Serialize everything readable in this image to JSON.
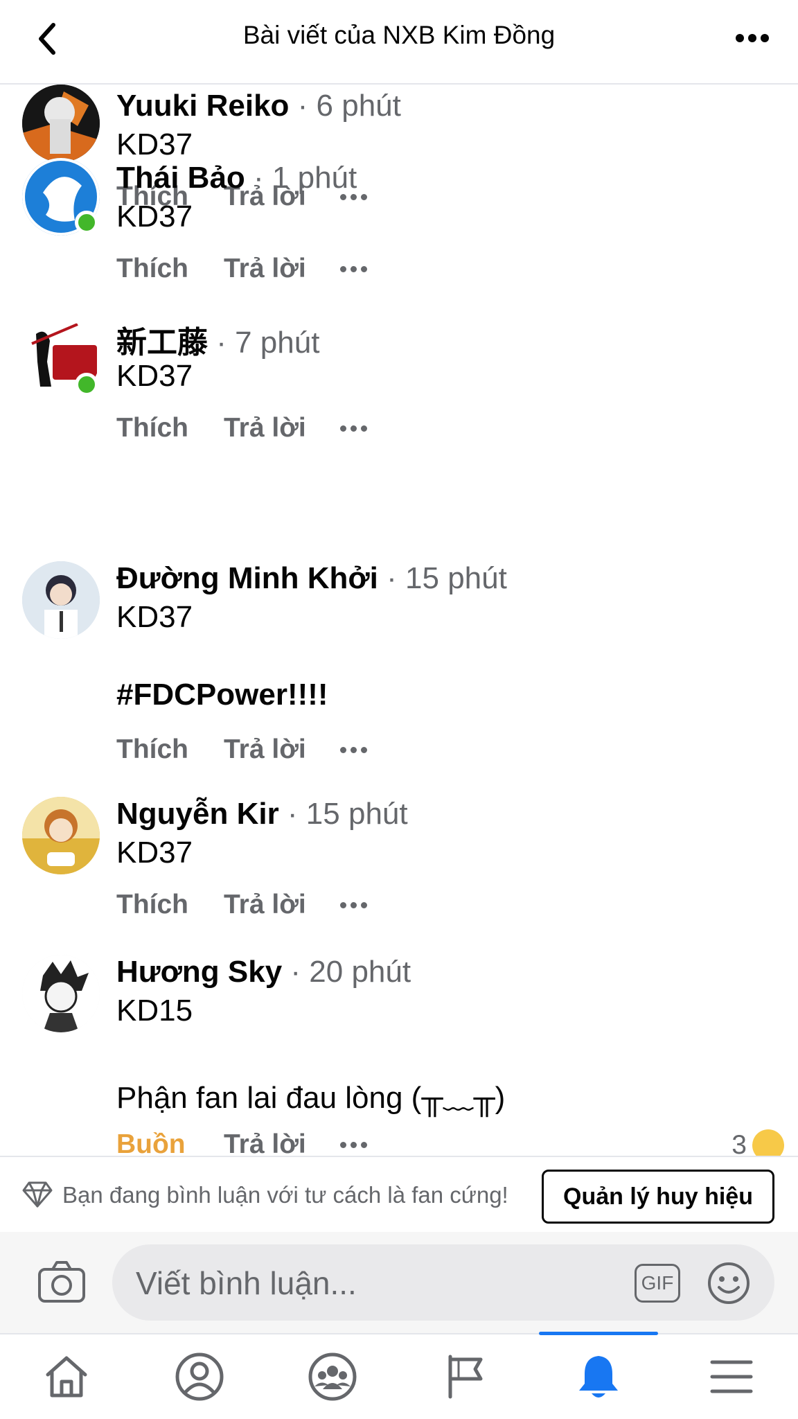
{
  "header": {
    "title": "Bài viết của NXB Kim Đồng"
  },
  "comments": [
    {
      "name": "Yuuki Reiko",
      "time": " · 6 phút",
      "lines": [
        "KD37"
      ],
      "online": false,
      "avatar_color": "#1b1b1b",
      "actions": {
        "like": "Thích",
        "reply": "Trả lời"
      }
    },
    {
      "name": "Thái Bảo",
      "time": " · 1 phút",
      "lines": [
        "KD37"
      ],
      "online": true,
      "avatar_color": "#1d7fd8",
      "actions": {
        "like": "Thích",
        "reply": "Trả lời"
      }
    },
    {
      "name": "新工藤",
      "time": " · 7 phút",
      "lines": [
        "KD37"
      ],
      "online": true,
      "avatar_color": "#b4151d",
      "actions": {
        "like": "Thích",
        "reply": "Trả lời"
      }
    },
    {
      "name": "Đường Minh Khởi",
      "time": " · 15 phút",
      "lines": [
        "KD37",
        "#FDCPower!!!!"
      ],
      "online": false,
      "avatar_color": "#c9d6e2",
      "actions": {
        "like": "Thích",
        "reply": "Trả lời"
      }
    },
    {
      "name": "Nguyễn Kir",
      "time": " · 15 phút",
      "lines": [
        "KD37"
      ],
      "online": false,
      "avatar_color": "#e0b43c",
      "actions": {
        "like": "Thích",
        "reply": "Trả lời"
      }
    },
    {
      "name": "Hương Sky",
      "time": " · 20 phút",
      "lines": [
        "KD15",
        "Phận fan lai đau lòng (╥﹏╥)"
      ],
      "online": false,
      "avatar_color": "#f0f0f0",
      "actions": {
        "like": "Buồn",
        "reply": "Trả lời"
      },
      "reaction_count": "3"
    }
  ],
  "fan_banner": {
    "text": "Bạn đang bình luận với tư cách là fan cứng!",
    "button": "Quản lý huy hiệu"
  },
  "composer": {
    "placeholder": "Viết bình luận...",
    "gif": "GIF"
  },
  "bottom_nav": {
    "items": [
      "home-icon",
      "profile-icon",
      "groups-icon",
      "pages-icon",
      "notifications-icon",
      "menu-icon"
    ],
    "active": "notifications-icon",
    "accent": "#1877f2"
  }
}
